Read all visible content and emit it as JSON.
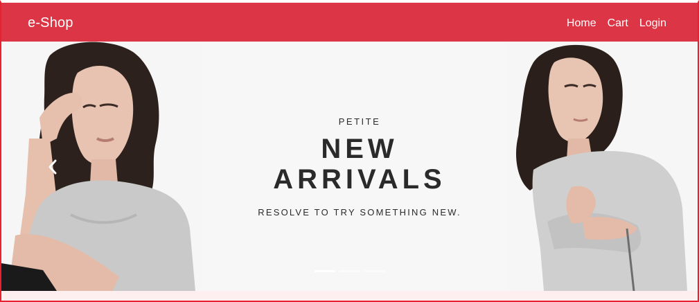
{
  "navbar": {
    "brand": "e-Shop",
    "links": [
      "Home",
      "Cart",
      "Login"
    ],
    "bg_color": "#dc3545"
  },
  "carousel": {
    "slide": {
      "eyebrow": "PETITE",
      "headline_line1": "NEW",
      "headline_line2": "ARRIVALS",
      "tagline": "RESOLVE TO TRY SOMETHING NEW."
    },
    "controls": {
      "prev_icon": "chevron-left-icon"
    },
    "indicators": {
      "count": 3,
      "active": 0
    }
  }
}
